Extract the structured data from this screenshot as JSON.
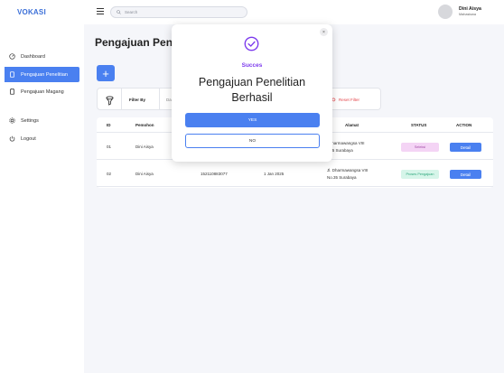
{
  "app": {
    "brand": "VOKASI"
  },
  "search": {
    "placeholder": "Search"
  },
  "user": {
    "name": "Dini Aisya",
    "role": "Mahasiswa"
  },
  "sidebar": {
    "items": [
      {
        "label": "Dashboard",
        "icon": "dashboard-icon",
        "active": false
      },
      {
        "label": "Pengajuan Penelitian",
        "icon": "document-icon",
        "active": true
      },
      {
        "label": "Pengajuan Magang",
        "icon": "document-icon",
        "active": false
      },
      {
        "label": "Settings",
        "icon": "gear-icon",
        "active": false
      },
      {
        "label": "Logout",
        "icon": "power-icon",
        "active": false
      }
    ]
  },
  "page": {
    "title": "Pengajuan Pen",
    "add_label": "+"
  },
  "filter": {
    "label": "Filter By",
    "date_placeholder": "Da",
    "reset_label": "Reset Filter"
  },
  "table": {
    "headers": [
      "ID",
      "Pemohon",
      "Alamat",
      "STATUS",
      "ACTION"
    ],
    "rows": [
      {
        "id": "01",
        "name": "Dini Aisya",
        "nim": "",
        "date": "",
        "address_line1": "Dharmawangsa VIII",
        "address_line2": ".35 Surabaya",
        "status": "Seleksi",
        "action": "Detail"
      },
      {
        "id": "02",
        "name": "Dini Aisya",
        "nim": "152110883077",
        "date": "1 Jan 2025",
        "address_line1": "Jl. Dharmawangsa VIII",
        "address_line2": "No.35 Surabaya",
        "status": "Proses Pengajuan",
        "action": "Detail"
      }
    ]
  },
  "modal": {
    "subtitle": "Succes",
    "title_line1": "Pengajuan Penelitian",
    "title_line2": "Berhasil",
    "yes_label": "YES",
    "no_label": "NO",
    "close_label": "×"
  },
  "colors": {
    "accent": "#4a80f0",
    "success_purple": "#7c3aed",
    "danger": "#e5484d"
  }
}
